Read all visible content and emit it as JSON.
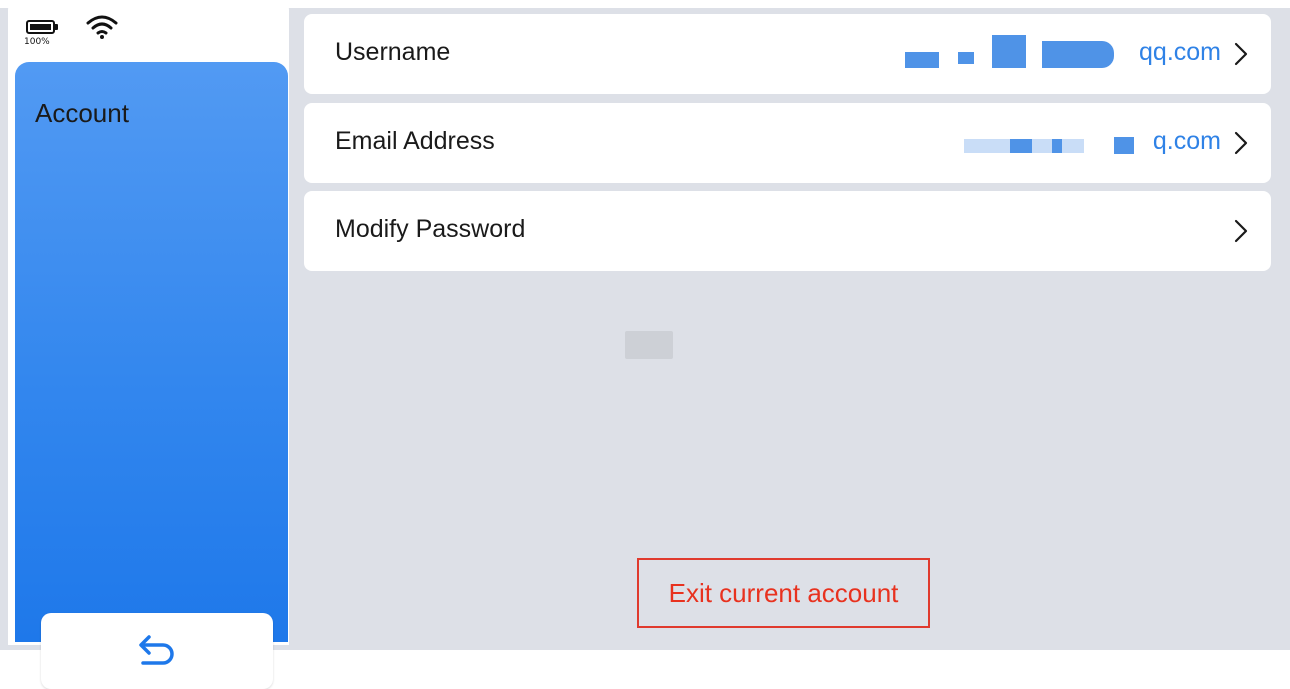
{
  "status": {
    "battery_level": "100%",
    "battery_icon": "battery-icon",
    "wifi_icon": "wifi-icon"
  },
  "sidebar": {
    "title": "Account",
    "back_icon": "back-arrow-icon"
  },
  "rows": [
    {
      "label": "Username",
      "value": "qq.com",
      "chevron_icon": "chevron-right-icon"
    },
    {
      "label": "Email Address",
      "value": "q.com",
      "chevron_icon": "chevron-right-icon"
    },
    {
      "label": "Modify Password",
      "value": "",
      "chevron_icon": "chevron-right-icon"
    }
  ],
  "exit_button": {
    "label": "Exit current account"
  },
  "colors": {
    "accent": "#2f82e6",
    "sidebar_gradient_top": "#529af3",
    "sidebar_gradient_bottom": "#1e78ea",
    "danger": "#e8321f",
    "background": "#dde0e7"
  }
}
